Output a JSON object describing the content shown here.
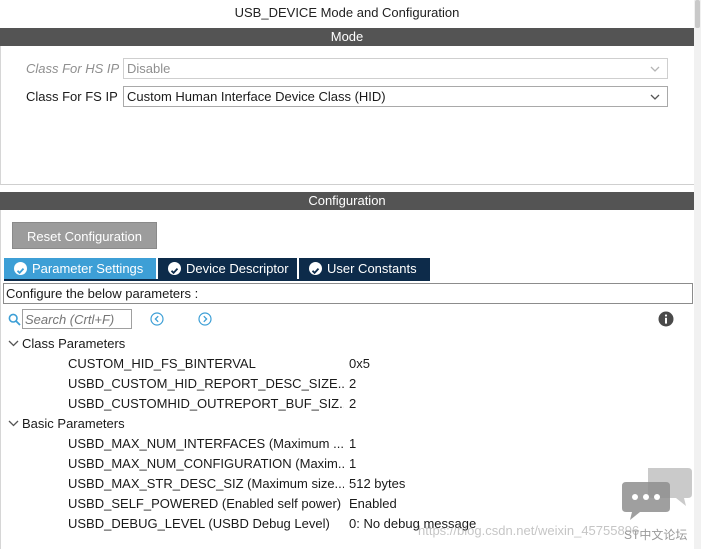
{
  "window": {
    "title": "USB_DEVICE Mode and Configuration"
  },
  "mode": {
    "header": "Mode",
    "fields": [
      {
        "label": "Class For HS IP",
        "value": "Disable",
        "disabled": true
      },
      {
        "label": "Class For FS IP",
        "value": "Custom Human Interface Device Class (HID)",
        "disabled": false
      }
    ]
  },
  "configuration": {
    "header": "Configuration",
    "reset_label": "Reset Configuration",
    "tabs": [
      {
        "label": "Parameter Settings",
        "active": true
      },
      {
        "label": "Device Descriptor",
        "active": false
      },
      {
        "label": "User Constants",
        "active": false
      }
    ],
    "hint": "Configure the below parameters :",
    "search": {
      "placeholder": "Search (Crtl+F)"
    },
    "groups": [
      {
        "label": "Class Parameters",
        "params": [
          {
            "name": "CUSTOM_HID_FS_BINTERVAL",
            "value": "0x5"
          },
          {
            "name": "USBD_CUSTOM_HID_REPORT_DESC_SIZE...",
            "value": "2"
          },
          {
            "name": "USBD_CUSTOMHID_OUTREPORT_BUF_SIZ...",
            "value": "2"
          }
        ]
      },
      {
        "label": "Basic Parameters",
        "params": [
          {
            "name": "USBD_MAX_NUM_INTERFACES (Maximum ...",
            "value": "1"
          },
          {
            "name": "USBD_MAX_NUM_CONFIGURATION (Maxim...",
            "value": "1"
          },
          {
            "name": "USBD_MAX_STR_DESC_SIZ (Maximum size...",
            "value": "512 bytes"
          },
          {
            "name": "USBD_SELF_POWERED (Enabled self power)",
            "value": "Enabled"
          },
          {
            "name": "USBD_DEBUG_LEVEL (USBD Debug Level)",
            "value": "0: No debug message"
          }
        ]
      }
    ]
  },
  "watermark": {
    "url_text": "https://blog.csdn.net/weixin_45755896",
    "caption": "ST中文论坛"
  },
  "colors": {
    "section_bar": "#545454",
    "tab_active": "#3d9fd6",
    "tab_inactive": "#0d2b4a",
    "reset_button": "#9c9c9c"
  }
}
